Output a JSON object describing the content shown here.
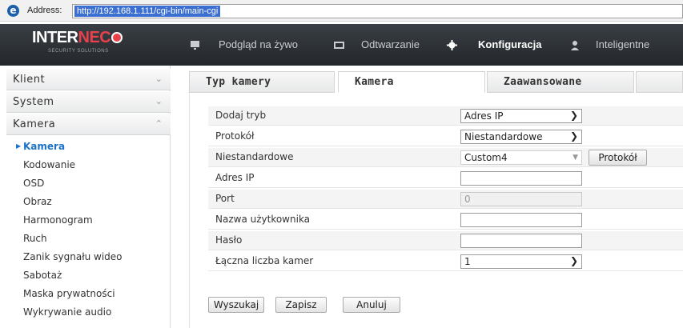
{
  "browser": {
    "address_label": "Address:",
    "url": "http://192.168.1.111/cgi-bin/main-cgi"
  },
  "brand": {
    "name_white": "INTER",
    "name_red": "NEC",
    "tagline": "SECURITY SOLUTIONS"
  },
  "nav": {
    "items": [
      {
        "label": "Podgląd na żywo",
        "icon": "monitor-icon"
      },
      {
        "label": "Odtwarzanie",
        "icon": "playback-icon"
      },
      {
        "label": "Konfiguracja",
        "icon": "gear-icon",
        "active": true
      },
      {
        "label": "Inteligentne",
        "icon": "person-icon"
      }
    ]
  },
  "sidebar": {
    "sections": [
      {
        "label": "Klient",
        "state": "collapsed"
      },
      {
        "label": "System",
        "state": "collapsed"
      },
      {
        "label": "Kamera",
        "state": "expanded"
      }
    ],
    "items": [
      {
        "label": "Kamera",
        "active": true
      },
      {
        "label": "Kodowanie"
      },
      {
        "label": "OSD"
      },
      {
        "label": "Obraz"
      },
      {
        "label": "Harmonogram"
      },
      {
        "label": "Ruch"
      },
      {
        "label": "Zanik sygnału wideo"
      },
      {
        "label": "Sabotaż"
      },
      {
        "label": "Maska prywatności"
      },
      {
        "label": "Wykrywanie audio"
      }
    ]
  },
  "tabs": [
    {
      "label": "Typ kamery"
    },
    {
      "label": "Kamera",
      "active": true
    },
    {
      "label": "Zaawansowane"
    }
  ],
  "form": {
    "rows": [
      {
        "label": "Dodaj tryb",
        "type": "select",
        "value": "Adres IP"
      },
      {
        "label": "Protokół",
        "type": "select",
        "value": "Niestandardowe"
      },
      {
        "label": "Niestandardowe",
        "type": "combo",
        "value": "Custom4",
        "button": "Protokół"
      },
      {
        "label": "Adres IP",
        "type": "text",
        "value": ""
      },
      {
        "label": "Port",
        "type": "text-disabled",
        "value": "0"
      },
      {
        "label": "Nazwa użytkownika",
        "type": "text",
        "value": ""
      },
      {
        "label": "Hasło",
        "type": "password",
        "value": ""
      },
      {
        "label": "Łączna liczba kamer",
        "type": "select",
        "value": "1"
      }
    ],
    "actions": {
      "search": "Wyszukaj",
      "save": "Zapisz",
      "cancel": "Anuluj"
    }
  },
  "colors": {
    "header_bg": "#2b2f33",
    "accent_blue": "#1a73c9",
    "brand_red": "#e8414c",
    "url_highlight": "#3b6fd1"
  }
}
